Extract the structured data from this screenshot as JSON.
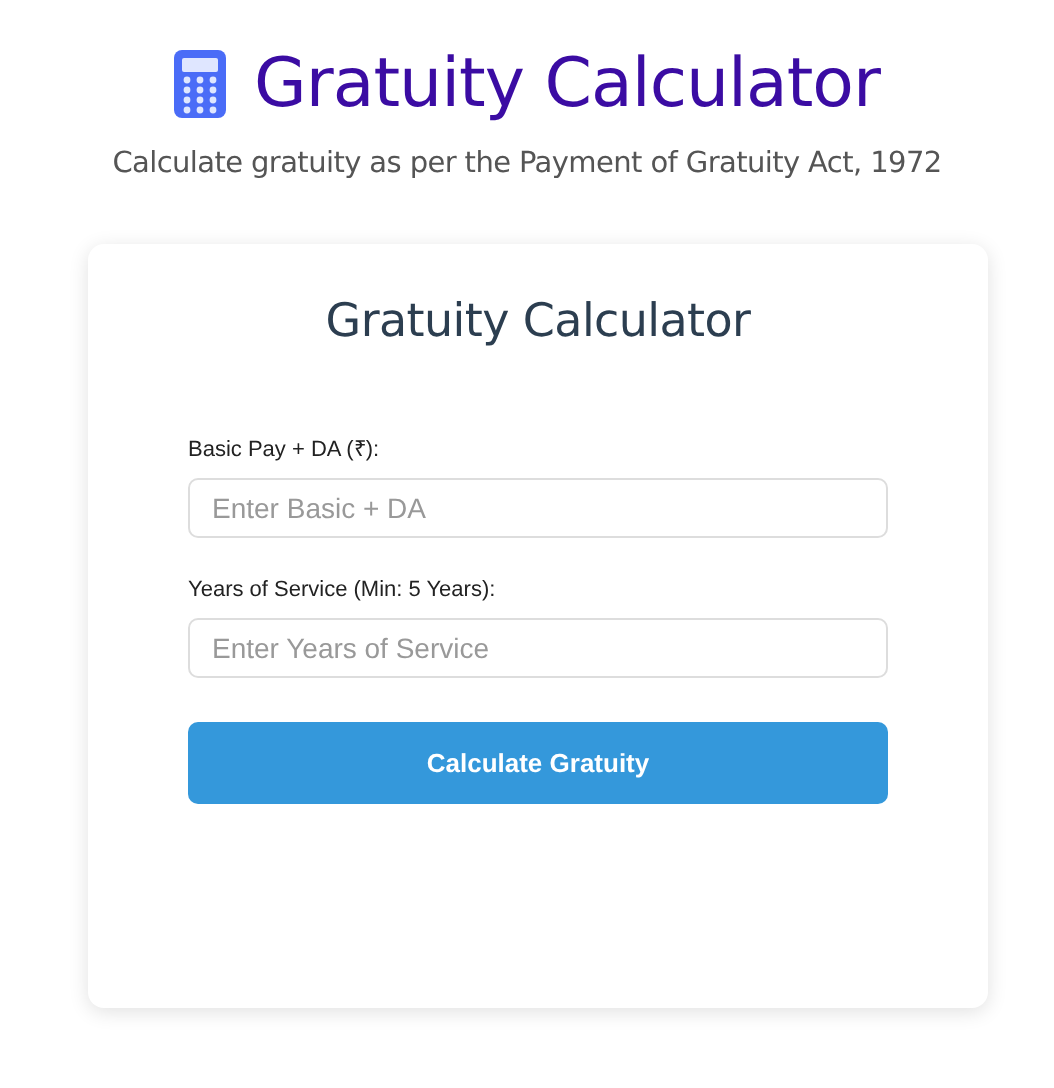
{
  "header": {
    "title": "Gratuity Calculator",
    "subtitle": "Calculate gratuity as per the Payment of Gratuity Act, 1972"
  },
  "card": {
    "title": "Gratuity Calculator",
    "fields": [
      {
        "label": "Basic Pay + DA (₹):",
        "placeholder": "Enter Basic + DA"
      },
      {
        "label": "Years of Service (Min: 5 Years):",
        "placeholder": "Enter Years of Service"
      }
    ],
    "button": "Calculate Gratuity"
  }
}
